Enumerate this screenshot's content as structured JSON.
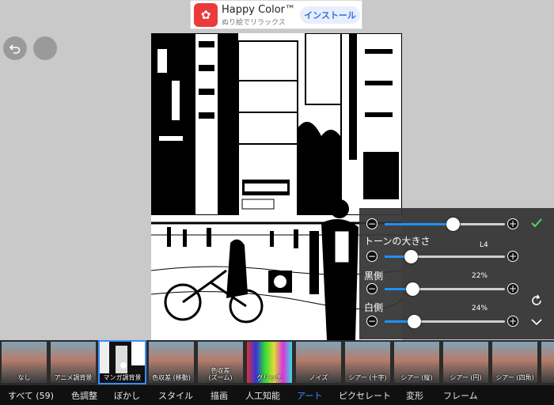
{
  "ad": {
    "title": "Happy Color™",
    "subtitle": "ぬり絵でリラックス",
    "install_label": "インストール"
  },
  "toolbar": {
    "back_icon": "undo-icon",
    "second_icon": "blank-circle-icon"
  },
  "panel": {
    "confirm_icon": "checkmark-icon",
    "reset_icon": "refresh-icon",
    "collapse_icon": "chevron-down-icon",
    "rows": [
      {
        "label": "",
        "value": "",
        "level": 0.63
      },
      {
        "label": "トーンの大きさ",
        "value": "L4",
        "level": 0.25
      },
      {
        "label": "黒側",
        "value": "22%",
        "level": 0.22
      },
      {
        "label": "白側",
        "value": "24%",
        "level": 0.24
      }
    ]
  },
  "thumbnails": [
    {
      "label": "なし"
    },
    {
      "label": "アニメ調背景"
    },
    {
      "label": "マンガ調背景"
    },
    {
      "label": "色収差 (移動)"
    },
    {
      "label": "色収差\n(ズーム)"
    },
    {
      "label": "グリッチ"
    },
    {
      "label": "ノイズ"
    },
    {
      "label": "シアー (十字)"
    },
    {
      "label": "シアー (縦)"
    },
    {
      "label": "シアー (円)"
    },
    {
      "label": "シアー (四角)"
    },
    {
      "label": ""
    }
  ],
  "selected_thumbnail": "マンガ調背景",
  "tabs": [
    "すべて (59)",
    "色調整",
    "ぼかし",
    "スタイル",
    "描画",
    "人工知能",
    "アート",
    "ピクセレート",
    "変形",
    "フレーム"
  ],
  "active_tab": "アート",
  "colors": {
    "accent": "#3a8cff",
    "confirm": "#4cd964",
    "slider_fill": "#1e90ff"
  }
}
